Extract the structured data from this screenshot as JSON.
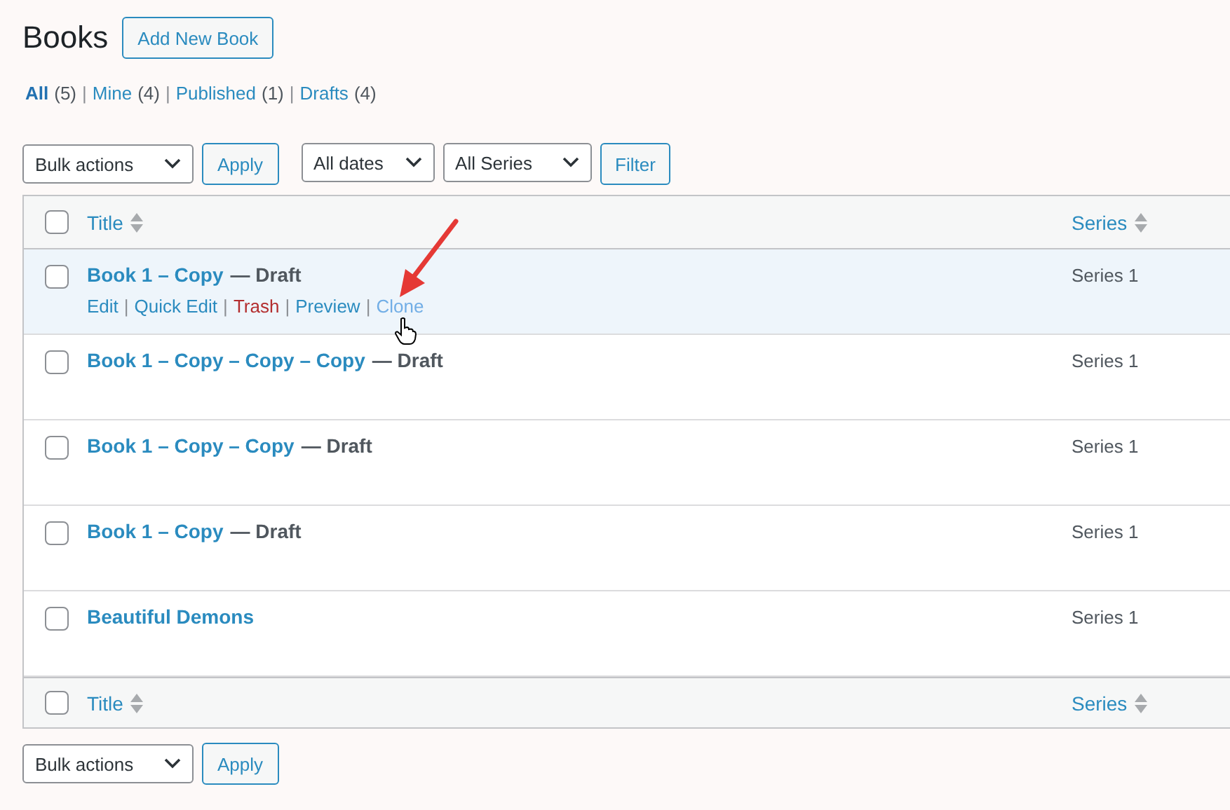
{
  "page": {
    "title": "Books",
    "add_button": "Add New Book"
  },
  "filters": [
    {
      "label": "All",
      "count": "(5)",
      "selected": true
    },
    {
      "separator": "|",
      "label": "Mine",
      "count": "(4)",
      "selected": false
    },
    {
      "separator": "|",
      "label": "Published",
      "count": "(1)",
      "selected": false
    },
    {
      "separator": "|",
      "label": "Drafts",
      "count": "(4)",
      "selected": false
    }
  ],
  "top_controls": {
    "bulk_actions": "Bulk actions",
    "apply": "Apply",
    "dates": "All dates",
    "series": "All Series",
    "filter": "Filter"
  },
  "table": {
    "header": {
      "checked": false,
      "columns": [
        {
          "label": "Title"
        },
        {
          "label": "Series"
        }
      ]
    },
    "rows": [
      {
        "title": "Book 1 – Copy",
        "state": "— Draft",
        "series": "Series 1",
        "hovered": true,
        "checked": false,
        "actions": [
          {
            "label": "Edit",
            "kind": "normal"
          },
          {
            "separator": "|",
            "label": "Quick Edit",
            "kind": "normal"
          },
          {
            "separator": "|",
            "label": "Trash",
            "kind": "danger"
          },
          {
            "separator": "|",
            "label": "Preview",
            "kind": "normal"
          },
          {
            "separator": "|",
            "label": "Clone",
            "kind": "hovered"
          }
        ]
      },
      {
        "title": "Book 1 – Copy – Copy – Copy",
        "state": "— Draft",
        "series": "Series 1",
        "hovered": false,
        "checked": false
      },
      {
        "title": "Book 1 – Copy – Copy",
        "state": "— Draft",
        "series": "Series 1",
        "hovered": false,
        "checked": false
      },
      {
        "title": "Book 1 – Copy",
        "state": "— Draft",
        "series": "Series 1",
        "hovered": false,
        "checked": false
      },
      {
        "title": "Beautiful Demons",
        "series": "Series 1",
        "hovered": false,
        "checked": false
      }
    ],
    "footer": {
      "checked": false,
      "columns": [
        {
          "label": "Title"
        },
        {
          "label": "Series"
        }
      ]
    }
  },
  "bottom_controls": {
    "bulk_actions": "Bulk actions",
    "apply": "Apply"
  }
}
